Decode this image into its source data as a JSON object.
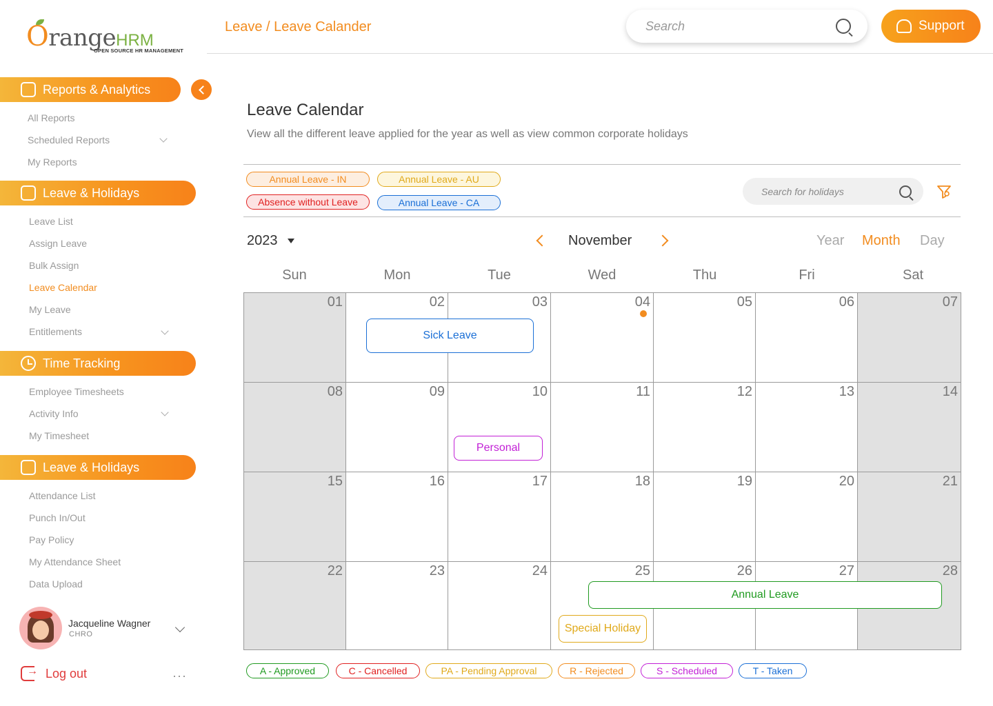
{
  "logo": {
    "brand_o": "O",
    "brand_rest": "range",
    "brand_hrm": "HRM",
    "tagline": "OPEN SOURCE HR MANAGEMENT"
  },
  "sidebar": {
    "section1": {
      "title": "Reports & Analytics",
      "icon": "clipboard-icon",
      "items": [
        {
          "label": "All Reports"
        },
        {
          "label": "Scheduled Reports",
          "expandable": true
        },
        {
          "label": "My Reports"
        }
      ]
    },
    "section2": {
      "title": "Leave & Holidays",
      "icon": "briefcase-icon",
      "items": [
        {
          "label": "Leave List"
        },
        {
          "label": "Assign Leave"
        },
        {
          "label": "Bulk Assign"
        },
        {
          "label": "Leave Calendar",
          "active": true
        },
        {
          "label": "My Leave"
        },
        {
          "label": "Entitlements",
          "expandable": true
        }
      ]
    },
    "section3": {
      "title": "Time Tracking",
      "icon": "clock-icon",
      "items": [
        {
          "label": "Employee Timesheets"
        },
        {
          "label": "Activity Info",
          "expandable": true
        },
        {
          "label": "My Timesheet"
        }
      ]
    },
    "section4": {
      "title": "Leave & Holidays",
      "icon": "briefcase-icon",
      "items": [
        {
          "label": "Attendance List"
        },
        {
          "label": "Punch In/Out"
        },
        {
          "label": "Pay Policy"
        },
        {
          "label": "My Attendance Sheet"
        },
        {
          "label": "Data Upload"
        }
      ]
    },
    "user": {
      "name": "Jacqueline Wagner",
      "role": "CHRO"
    },
    "logout": "Log out",
    "more": "···"
  },
  "topbar": {
    "breadcrumb_parent": "Leave",
    "breadcrumb_sep": " / ",
    "breadcrumb_current": "Leave Calander",
    "search_placeholder": "Search",
    "support_label": "Support"
  },
  "main": {
    "title": "Leave Calendar",
    "subtitle": "View all the different leave applied for the year as well as view common corporate holidays",
    "leave_types": [
      {
        "label": "Annual Leave - IN",
        "color": "#f28c1f",
        "bg": "#fdeee0"
      },
      {
        "label": "Annual Leave - AU",
        "color": "#e0a91a",
        "bg": "#fdf6dd"
      },
      {
        "label": "Absence without Leave",
        "color": "#e02020",
        "bg": "#fde3e3"
      },
      {
        "label": "Annual Leave - CA",
        "color": "#1a6fd6",
        "bg": "#e3eefc"
      }
    ],
    "holiday_search_placeholder": "Search for holidays",
    "year": "2023",
    "month": "November",
    "views": [
      "Year",
      "Month",
      "Day"
    ],
    "active_view": "Month",
    "weekdays": [
      "Sun",
      "Mon",
      "Tue",
      "Wed",
      "Thu",
      "Fri",
      "Sat"
    ],
    "weeks": [
      [
        "01",
        "02",
        "03",
        "04",
        "05",
        "06",
        "07"
      ],
      [
        "08",
        "09",
        "10",
        "11",
        "12",
        "13",
        "14"
      ],
      [
        "15",
        "16",
        "17",
        "18",
        "19",
        "20",
        "21"
      ],
      [
        "22",
        "23",
        "24",
        "25",
        "26",
        "27",
        "28"
      ]
    ],
    "events": [
      {
        "label": "Sick Leave",
        "color": "#1a6fd6"
      },
      {
        "label": "Personal",
        "color": "#c21fd6"
      },
      {
        "label": "Annual Leave",
        "color": "#1f9a1f"
      },
      {
        "label": "Special Holiday",
        "color": "#e0a91a"
      }
    ],
    "status_legend": [
      {
        "label": "A - Approved",
        "color": "#1f9a1f"
      },
      {
        "label": "C - Cancelled",
        "color": "#e02020"
      },
      {
        "label": "PA - Pending Approval",
        "color": "#e0a91a"
      },
      {
        "label": "R - Rejected",
        "color": "#f28c1f"
      },
      {
        "label": "S - Scheduled",
        "color": "#c21fd6"
      },
      {
        "label": "T - Taken",
        "color": "#1a6fd6"
      }
    ]
  }
}
